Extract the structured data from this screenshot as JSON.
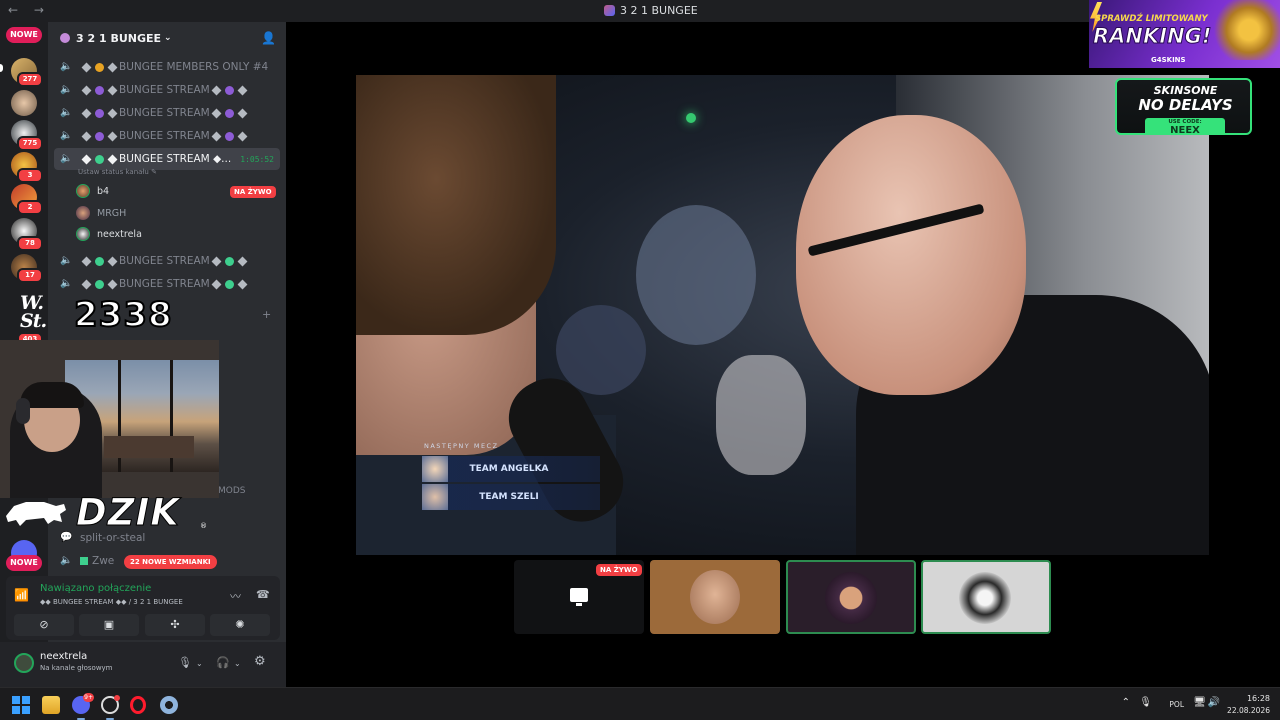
{
  "window": {
    "title": "3 2 1 BUNGEE",
    "nav": "← →"
  },
  "rail": {
    "new_top": "NOWE",
    "new_bottom": "NOWE",
    "badges": [
      "277",
      "775",
      "3",
      "2",
      "78",
      "17",
      "403"
    ]
  },
  "server": {
    "name": "3 2 1 BUNGEE",
    "channels": [
      {
        "name": "BUNGEE MEMBERS ONLY #4",
        "orb": "#e8a323"
      },
      {
        "name": "BUNGEE STREAM",
        "orb": "#8d5cd6"
      },
      {
        "name": "BUNGEE STREAM",
        "orb": "#8d5cd6"
      },
      {
        "name": "BUNGEE STREAM",
        "orb": "#8d5cd6"
      }
    ],
    "active_channel": {
      "name": "BUNGEE STREAM ◆...",
      "timer": "1:05:52",
      "status_hint": "Ustaw status kanału ✎",
      "orb": "#3ecf8e"
    },
    "voice_users": [
      {
        "name": "b4",
        "live": "NA ŻYWO"
      },
      {
        "name": "MRGH"
      },
      {
        "name": "neextrela"
      }
    ],
    "more_channels": [
      {
        "name": "BUNGEE STREAM",
        "orb": "#3ecf8e"
      },
      {
        "name": "BUNGEE STREAM",
        "orb": "#3ecf8e"
      }
    ],
    "lower": {
      "mods_fragment": "MODS",
      "text_channel": "split-or-steal",
      "partial_channel": "Zwe",
      "mentions_pill": "22 NOWE WZMIANKI"
    }
  },
  "overlay": {
    "signature": "W.\nSt.",
    "counter": "2338",
    "brand": "DZIK",
    "reg": "®"
  },
  "voice_panel": {
    "status": "Nawiązano połączenie",
    "channel_path": "◆◆ BUNGEE STREAM ◆◆ / 3 2 1 BUNGEE"
  },
  "user_panel": {
    "name": "neextrela",
    "sub": "Na kanale głosowym"
  },
  "stage": {
    "next_match_label": "NASTĘPNY MECZ",
    "teams": [
      "TEAM ANGELKA",
      "TEAM SZELI"
    ],
    "screen_share_live": "NA ŻYWO"
  },
  "ads": {
    "ad1_small": "SPRAWDŹ LIMITOWANY",
    "ad1_big": "RANKING!",
    "ad1_brand": "G4SKINS",
    "ad2_line1": "SKINSONE",
    "ad2_line2": "NO DELAYS",
    "ad2_code_label": "USE CODE:",
    "ad2_code": "NEEX"
  },
  "taskbar": {
    "discord_badge": "9+",
    "lang": "POL",
    "time": "16:28",
    "date": "22.08.2026"
  }
}
